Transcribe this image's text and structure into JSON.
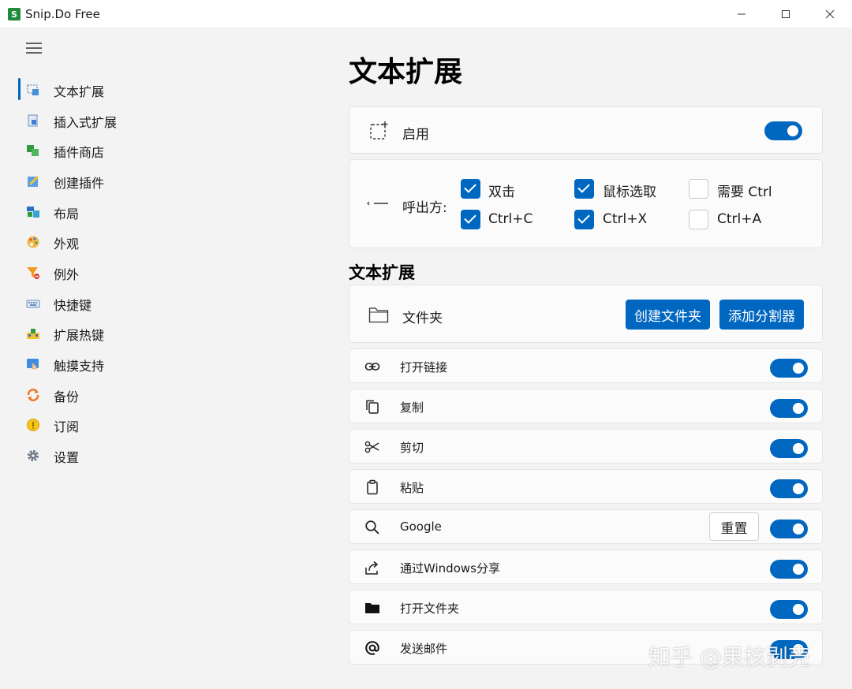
{
  "window": {
    "logo_letter": "S",
    "title": "Snip.Do Free"
  },
  "sidebar": {
    "items": [
      {
        "label": "文本扩展",
        "icon": "text-expand-icon",
        "selected": true
      },
      {
        "label": "插入式扩展",
        "icon": "insert-expand-icon"
      },
      {
        "label": "插件商店",
        "icon": "plugin-store-icon"
      },
      {
        "label": "创建插件",
        "icon": "create-plugin-icon"
      },
      {
        "label": "布局",
        "icon": "layout-icon"
      },
      {
        "label": "外观",
        "icon": "palette-icon"
      },
      {
        "label": "例外",
        "icon": "filter-exception-icon"
      },
      {
        "label": "快捷键",
        "icon": "keyboard-icon"
      },
      {
        "label": "扩展热键",
        "icon": "hotkey-icon"
      },
      {
        "label": "触摸支持",
        "icon": "touch-icon"
      },
      {
        "label": "备份",
        "icon": "backup-icon"
      },
      {
        "label": "订阅",
        "icon": "subscription-icon"
      },
      {
        "label": "设置",
        "icon": "gear-icon"
      }
    ]
  },
  "main": {
    "title": "文本扩展",
    "enable": {
      "label": "启用",
      "on": true
    },
    "invoke": {
      "label": "呼出方:",
      "options": [
        {
          "label": "双击",
          "checked": true
        },
        {
          "label": "鼠标选取",
          "checked": true
        },
        {
          "label": "需要 Ctrl",
          "checked": false
        },
        {
          "label": "Ctrl+C",
          "checked": true
        },
        {
          "label": "Ctrl+X",
          "checked": true
        },
        {
          "label": "Ctrl+A",
          "checked": false
        }
      ]
    },
    "section_title": "文本扩展",
    "folder": {
      "label": "文件夹",
      "create_button": "创建文件夹",
      "separator_button": "添加分割器"
    },
    "extensions": [
      {
        "label": "打开链接",
        "icon": "link-icon",
        "on": true
      },
      {
        "label": "复制",
        "icon": "copy-icon",
        "on": true
      },
      {
        "label": "剪切",
        "icon": "scissors-icon",
        "on": true
      },
      {
        "label": "粘贴",
        "icon": "clipboard-icon",
        "on": true
      },
      {
        "label": "Google",
        "icon": "search-icon",
        "on": true,
        "reset_button": "重置"
      },
      {
        "label": "通过Windows分享",
        "icon": "share-icon",
        "on": true
      },
      {
        "label": "打开文件夹",
        "icon": "folder-icon",
        "on": true
      },
      {
        "label": "发送邮件",
        "icon": "at-sign-icon",
        "on": true
      }
    ]
  },
  "watermark": "知乎 @果核剥壳",
  "colors": {
    "accent": "#0067c0",
    "background": "#f3f3f3",
    "card": "#fbfbfb"
  }
}
